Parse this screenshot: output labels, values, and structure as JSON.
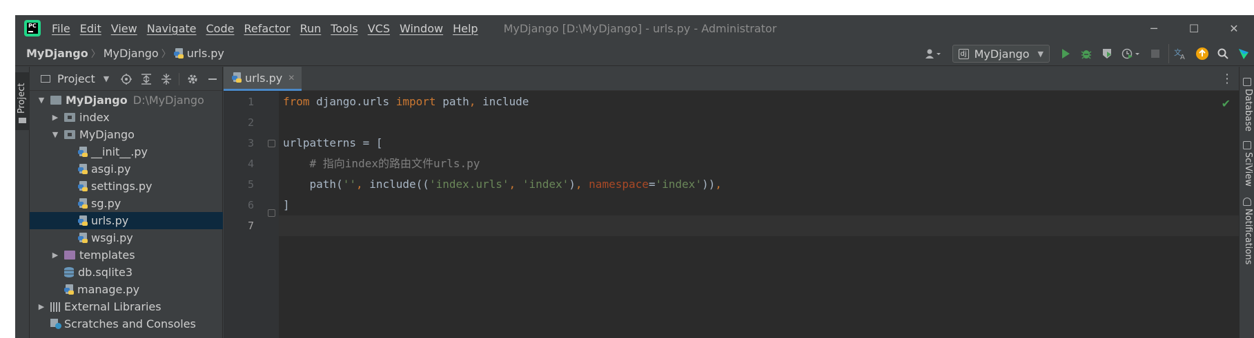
{
  "app": {
    "logo_text": "PC",
    "window_title": "MyDjango [D:\\MyDjango] - urls.py - Administrator"
  },
  "menu": [
    "File",
    "Edit",
    "View",
    "Navigate",
    "Code",
    "Refactor",
    "Run",
    "Tools",
    "VCS",
    "Window",
    "Help"
  ],
  "window_controls": {
    "minimize": "─",
    "maximize": "☐",
    "close": "✕"
  },
  "breadcrumb": {
    "project": "MyDjango",
    "folder": "MyDjango",
    "file": "urls.py"
  },
  "toolbar": {
    "run_config": "MyDjango",
    "icons": [
      "user-icon",
      "run-icon",
      "debug-icon",
      "coverage-icon",
      "profile-icon",
      "stop-icon",
      "translate-icon",
      "update-icon",
      "search-icon",
      "jetbrains-icon"
    ]
  },
  "left_strip": {
    "project_tab": "Project"
  },
  "project_panel": {
    "title": "Project",
    "tree": [
      {
        "label": "MyDjango",
        "path": "D:\\MyDjango",
        "type": "root",
        "expanded": true
      },
      {
        "label": "index",
        "type": "package",
        "expanded": false
      },
      {
        "label": "MyDjango",
        "type": "package",
        "expanded": true
      },
      {
        "label": "__init__.py",
        "type": "python"
      },
      {
        "label": "asgi.py",
        "type": "python"
      },
      {
        "label": "settings.py",
        "type": "python"
      },
      {
        "label": "sg.py",
        "type": "python"
      },
      {
        "label": "urls.py",
        "type": "python",
        "selected": true
      },
      {
        "label": "wsgi.py",
        "type": "python"
      },
      {
        "label": "templates",
        "type": "folder-purple",
        "expanded": false
      },
      {
        "label": "db.sqlite3",
        "type": "database"
      },
      {
        "label": "manage.py",
        "type": "python"
      },
      {
        "label": "External Libraries",
        "type": "libraries",
        "expanded": false
      },
      {
        "label": "Scratches and Consoles",
        "type": "scratches"
      }
    ]
  },
  "editor": {
    "tab_label": "urls.py",
    "line_numbers": [
      "1",
      "2",
      "3",
      "4",
      "5",
      "6",
      "7"
    ],
    "current_line": 7,
    "lines": [
      [
        {
          "t": "from",
          "c": "kw"
        },
        {
          "t": " django.urls ",
          "c": ""
        },
        {
          "t": "import",
          "c": "kw"
        },
        {
          "t": " path",
          "c": ""
        },
        {
          "t": ",",
          "c": "punc"
        },
        {
          "t": " include",
          "c": ""
        }
      ],
      [],
      [
        {
          "t": "urlpatterns = [",
          "c": ""
        }
      ],
      [
        {
          "t": "    ",
          "c": ""
        },
        {
          "t": "# 指向index的路由文件urls.py",
          "c": "cmt"
        }
      ],
      [
        {
          "t": "    path(",
          "c": ""
        },
        {
          "t": "''",
          "c": "str"
        },
        {
          "t": ",",
          "c": "punc"
        },
        {
          "t": " include((",
          "c": ""
        },
        {
          "t": "'index.urls'",
          "c": "str"
        },
        {
          "t": ",",
          "c": "punc"
        },
        {
          "t": " ",
          "c": ""
        },
        {
          "t": "'index'",
          "c": "str"
        },
        {
          "t": ")",
          "c": ""
        },
        {
          "t": ",",
          "c": "punc"
        },
        {
          "t": " ",
          "c": ""
        },
        {
          "t": "namespace",
          "c": "named"
        },
        {
          "t": "=",
          "c": ""
        },
        {
          "t": "'index'",
          "c": "str"
        },
        {
          "t": "))",
          "c": ""
        },
        {
          "t": ",",
          "c": "punc"
        }
      ],
      [
        {
          "t": "]",
          "c": ""
        }
      ],
      []
    ],
    "status": "✔"
  },
  "right_strip": [
    "Database",
    "SciView",
    "Notifications"
  ]
}
